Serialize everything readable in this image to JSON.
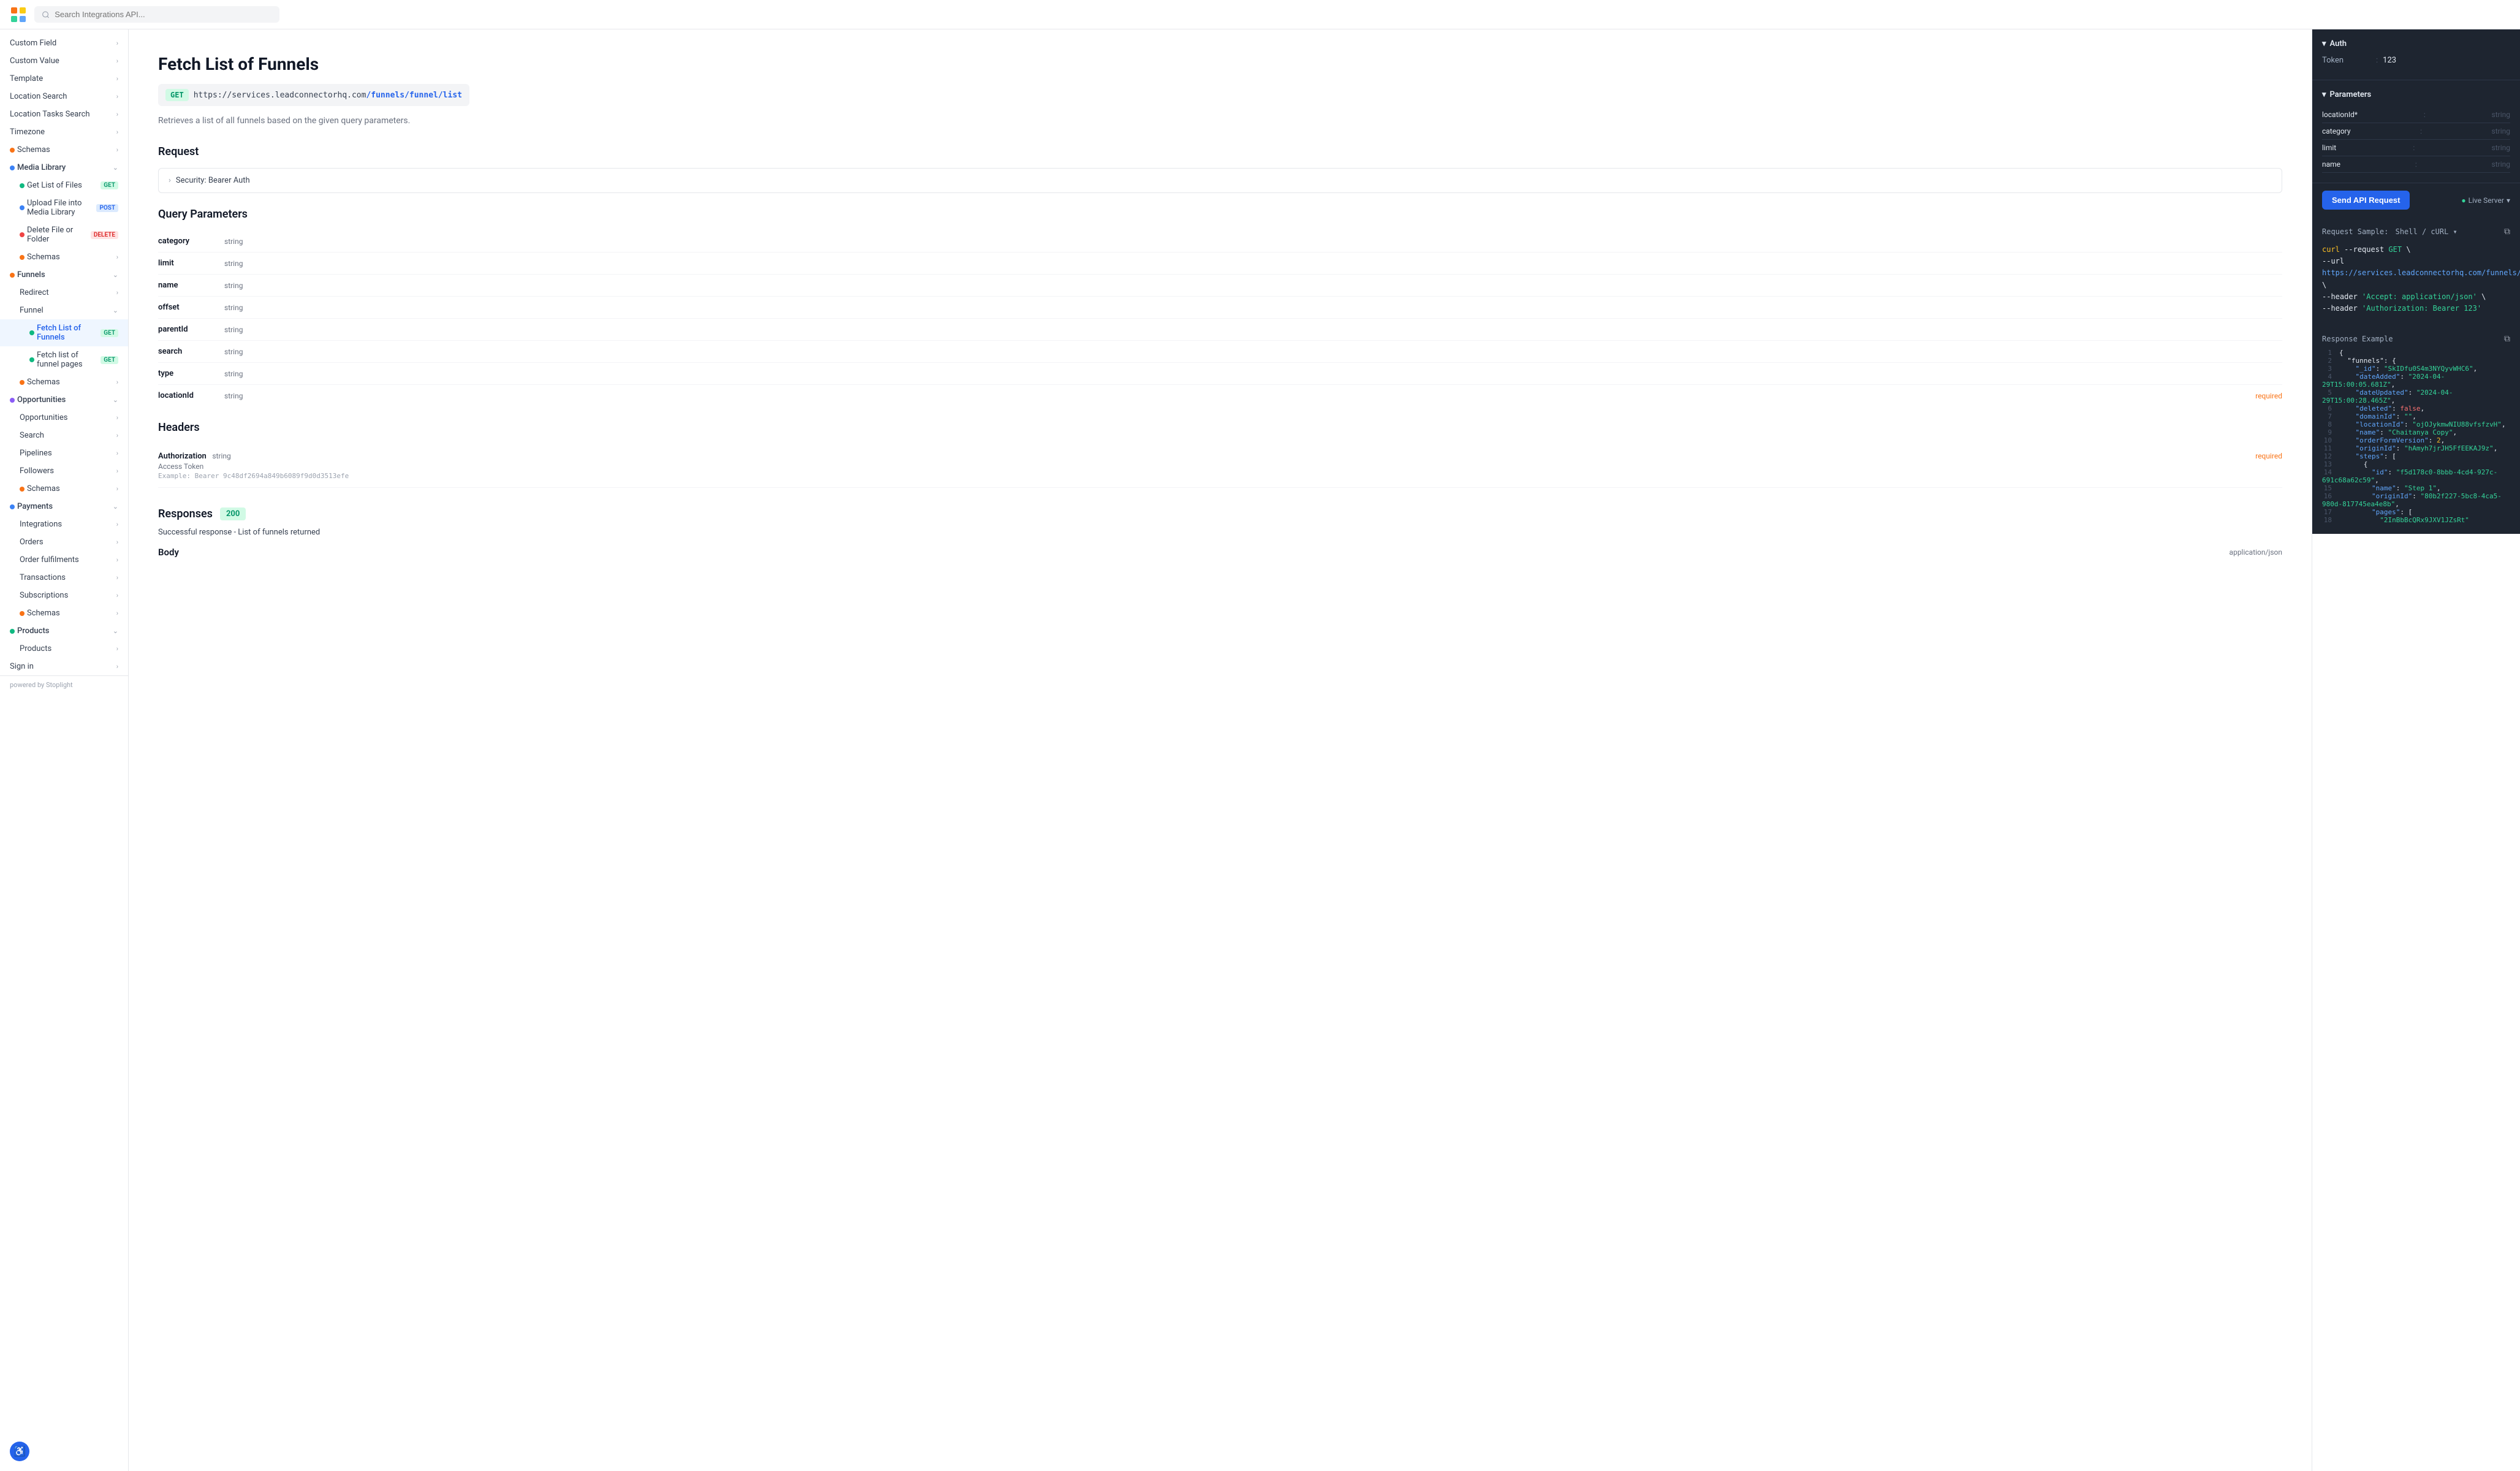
{
  "topbar": {
    "search_placeholder": "Search Integrations API..."
  },
  "sidebar": {
    "items": [
      {
        "id": "custom-field",
        "label": "Custom Field",
        "type": "expandable",
        "indent": 0
      },
      {
        "id": "custom-value",
        "label": "Custom Value",
        "type": "expandable",
        "indent": 0
      },
      {
        "id": "template",
        "label": "Template",
        "type": "expandable",
        "indent": 0
      },
      {
        "id": "location-search",
        "label": "Location Search",
        "type": "expandable",
        "indent": 0
      },
      {
        "id": "location-tasks-search",
        "label": "Location Tasks Search",
        "type": "expandable",
        "indent": 0
      },
      {
        "id": "timezone",
        "label": "Timezone",
        "type": "expandable",
        "indent": 0
      },
      {
        "id": "schemas-1",
        "label": "Schemas",
        "type": "expandable",
        "indent": 0,
        "icon": "schemas"
      },
      {
        "id": "media-library",
        "label": "Media Library",
        "type": "expanded",
        "indent": 0,
        "icon": "media"
      },
      {
        "id": "get-list-of-files",
        "label": "Get List of Files",
        "type": "sub",
        "badge": "GET",
        "indent": 1
      },
      {
        "id": "upload-file",
        "label": "Upload File into Media Library",
        "type": "sub",
        "badge": "POST",
        "indent": 1
      },
      {
        "id": "delete-file",
        "label": "Delete File or Folder",
        "type": "sub",
        "badge": "DELETE",
        "indent": 1
      },
      {
        "id": "schemas-2",
        "label": "Schemas",
        "type": "sub-expandable",
        "indent": 1,
        "icon": "schemas"
      },
      {
        "id": "funnels",
        "label": "Funnels",
        "type": "expanded",
        "indent": 0,
        "icon": "funnels"
      },
      {
        "id": "redirect",
        "label": "Redirect",
        "type": "sub-expandable",
        "indent": 1
      },
      {
        "id": "funnel",
        "label": "Funnel",
        "type": "sub-expanded",
        "indent": 1
      },
      {
        "id": "fetch-list-of-funnels",
        "label": "Fetch List of Funnels",
        "type": "sub-active",
        "badge": "GET",
        "indent": 2
      },
      {
        "id": "fetch-list-funnel-pages",
        "label": "Fetch list of funnel pages",
        "type": "sub",
        "badge": "GET",
        "indent": 2
      },
      {
        "id": "schemas-3",
        "label": "Schemas",
        "type": "sub-expandable",
        "indent": 1,
        "icon": "schemas"
      },
      {
        "id": "opportunities",
        "label": "Opportunities",
        "type": "expanded",
        "indent": 0,
        "icon": "opportunities"
      },
      {
        "id": "opportunities-sub",
        "label": "Opportunities",
        "type": "sub-expandable",
        "indent": 1
      },
      {
        "id": "search",
        "label": "Search",
        "type": "sub-expandable",
        "indent": 1
      },
      {
        "id": "pipelines",
        "label": "Pipelines",
        "type": "sub-expandable",
        "indent": 1
      },
      {
        "id": "followers",
        "label": "Followers",
        "type": "sub-expandable",
        "indent": 1
      },
      {
        "id": "schemas-4",
        "label": "Schemas",
        "type": "sub-expandable",
        "indent": 1,
        "icon": "schemas"
      },
      {
        "id": "payments",
        "label": "Payments",
        "type": "expanded",
        "indent": 0,
        "icon": "payments"
      },
      {
        "id": "integrations",
        "label": "Integrations",
        "type": "sub-expandable",
        "indent": 1
      },
      {
        "id": "orders",
        "label": "Orders",
        "type": "sub-expandable",
        "indent": 1
      },
      {
        "id": "order-fulfillments",
        "label": "Order fulfilments",
        "type": "sub-expandable",
        "indent": 1
      },
      {
        "id": "transactions",
        "label": "Transactions",
        "type": "sub-expandable",
        "indent": 1
      },
      {
        "id": "subscriptions",
        "label": "Subscriptions",
        "type": "sub-expandable",
        "indent": 1
      },
      {
        "id": "schemas-5",
        "label": "Schemas",
        "type": "sub-expandable",
        "indent": 1,
        "icon": "schemas"
      },
      {
        "id": "products",
        "label": "Products",
        "type": "expanded",
        "indent": 0,
        "icon": "products"
      },
      {
        "id": "products-sub",
        "label": "Products",
        "type": "sub-expandable",
        "indent": 1
      },
      {
        "id": "sign-in",
        "label": "Sign in",
        "type": "expandable",
        "indent": 0
      }
    ],
    "powered_by": "powered by Stoplight"
  },
  "main": {
    "title": "Fetch List of Funnels",
    "method": "GET",
    "endpoint": "https://services.leadconnectorhq.com/funnels/funnel/list",
    "endpoint_highlight": "/funnels/funnel/list",
    "description": "Retrieves a list of all funnels based on the given query parameters.",
    "request_section": "Request",
    "security_label": "Security: Bearer Auth",
    "query_params_title": "Query Parameters",
    "params": [
      {
        "name": "category",
        "type": "string",
        "required": false
      },
      {
        "name": "limit",
        "type": "string",
        "required": false
      },
      {
        "name": "name",
        "type": "string",
        "required": false
      },
      {
        "name": "offset",
        "type": "string",
        "required": false
      },
      {
        "name": "parentId",
        "type": "string",
        "required": false
      },
      {
        "name": "search",
        "type": "string",
        "required": false
      },
      {
        "name": "type",
        "type": "string",
        "required": false
      },
      {
        "name": "locationId",
        "type": "string",
        "required": true
      }
    ],
    "headers_title": "Headers",
    "headers": [
      {
        "name": "Authorization",
        "type": "string",
        "required": true,
        "desc": "Access Token",
        "example": "Bearer 9c48df2694a849b6089f9d0d3513efe"
      }
    ],
    "responses_title": "Responses",
    "response_status": "200",
    "response_desc": "Successful response - List of funnels returned",
    "body_label": "Body",
    "body_type": "application/json"
  },
  "right_panel": {
    "auth_section": "Auth",
    "token_label": "Token",
    "token_value": "123",
    "params_section": "Parameters",
    "params": [
      {
        "name": "locationId*",
        "colon": ":",
        "type": "string"
      },
      {
        "name": "category",
        "colon": ":",
        "type": "string"
      },
      {
        "name": "limit",
        "colon": ":",
        "type": "string"
      },
      {
        "name": "name",
        "colon": ":",
        "type": "string"
      }
    ],
    "send_btn": "Send API Request",
    "server_label": "Live Server",
    "request_sample_label": "Request Sample:",
    "request_sample_type": "Shell / cURL",
    "request_code": [
      "curl --request GET \\",
      "  --url https://services.leadconnectorhq.com/funnels/funnel/list \\",
      "  --header 'Accept: application/json' \\",
      "  --header 'Authorization: Bearer 123'"
    ],
    "response_example_label": "Response Example",
    "response_lines": [
      {
        "num": 1,
        "text": "{"
      },
      {
        "num": 2,
        "text": "  \"funnels\": {"
      },
      {
        "num": 3,
        "text": "    \"_id\": \"SkIDfu0S4m3NYQyvWHC6\","
      },
      {
        "num": 4,
        "text": "    \"dateAdded\": \"2024-04-29T15:00:05.681Z\","
      },
      {
        "num": 5,
        "text": "    \"dateUpdated\": \"2024-04-29T15:00:28.465Z\","
      },
      {
        "num": 6,
        "text": "    \"deleted\": false,"
      },
      {
        "num": 7,
        "text": "    \"domainId\": \"\","
      },
      {
        "num": 8,
        "text": "    \"locationId\": \"ojOJykmwNIU88vfsfzvH\","
      },
      {
        "num": 9,
        "text": "    \"name\": \"Chaitanya Copy\","
      },
      {
        "num": 10,
        "text": "    \"orderFormVersion\": 2,"
      },
      {
        "num": 11,
        "text": "    \"originId\": \"hAmyh7jrJH5FfEEKAJ9z\","
      },
      {
        "num": 12,
        "text": "    \"steps\": ["
      },
      {
        "num": 13,
        "text": "      {"
      },
      {
        "num": 14,
        "text": "        \"id\": \"f5d178c0-8bbb-4cd4-927c-691c68a62c59\","
      },
      {
        "num": 15,
        "text": "        \"name\": \"Step 1\","
      },
      {
        "num": 16,
        "text": "        \"originId\": \"80b2f227-5bc8-4ca5-980d-817745ea4e8b\","
      },
      {
        "num": 17,
        "text": "        \"pages\": ["
      },
      {
        "num": 18,
        "text": "          \"2InBbBcQRx9JXV1JZsRt\""
      }
    ]
  }
}
